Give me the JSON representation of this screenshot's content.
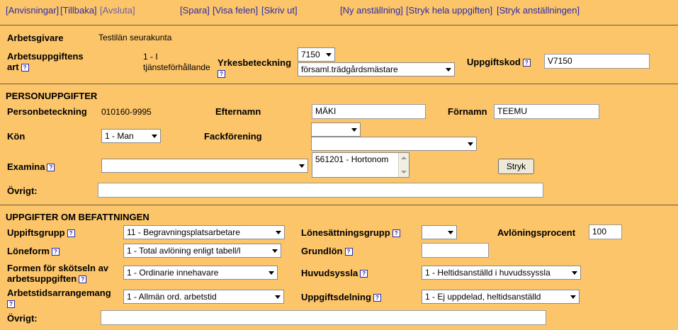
{
  "nav": {
    "anvisningar": "[Anvisningar]",
    "tillbaka": "[Tillbaka]",
    "avsluta": "[Avsluta]",
    "spara": "[Spara]",
    "visa_felen": "[Visa felen]",
    "skriv_ut": "[Skriv ut]",
    "ny_anstallning": "[Ny anställning]",
    "stryk_uppgiften": "[Stryk hela uppgiften]",
    "stryk_anstallningen": "[Stryk anställningen]"
  },
  "top": {
    "arbetsgivare_label": "Arbetsgivare",
    "arbetsgivare_value": "Testilän seurakunta",
    "art_label_1": "Arbetsuppgiftens",
    "art_label_2": "art",
    "art_value_1": "1 - I",
    "art_value_2": "tjänsteförhållande",
    "yrkes_label": "Yrkesbeteckning",
    "yrkes_code": "7150",
    "yrkes_name": "församl.trädgårdsmästare",
    "uppgiftskod_label": "Uppgiftskod",
    "uppgiftskod_value": "V7150"
  },
  "person": {
    "section_title": "PERSONUPPGIFTER",
    "personbeteckning_label": "Personbeteckning",
    "personbeteckning_value": "010160-9995",
    "efternamn_label": "Efternamn",
    "efternamn_value": "MÄKI",
    "fornamn_label": "Förnamn",
    "fornamn_value": "TEEMU",
    "kon_label": "Kön",
    "kon_value": "1 - Man",
    "fack_label": "Fackförening",
    "fack_value_1": "",
    "fack_value_2": "",
    "examina_label": "Examina",
    "examina_select": "",
    "examina_list": [
      "561201 - Hortonom"
    ],
    "stryk_label": "Stryk",
    "ovrigt_label": "Övrigt:",
    "ovrigt_value": ""
  },
  "job": {
    "section_title": "UPPGIFTER OM BEFATTNINGEN",
    "uppgiftsgrupp_label": "Uppiftsgrupp",
    "uppgiftsgrupp_value": "11 - Begravningsplatsarbetare",
    "lonesattning_label": "Lönesättningsgrupp",
    "lonesattning_value": "",
    "avloning_label": "Avlöningsprocent",
    "avloning_value": "100",
    "loneform_label": "Löneform",
    "loneform_value": "1 - Total avlöning enligt tabell/l",
    "grundlon_label": "Grundlön",
    "grundlon_value": "",
    "formen_label_1": "Formen för skötseln av",
    "formen_label_2": "arbetsuppgiften",
    "formen_value": "1 - Ordinarie innehavare",
    "huvudsyssla_label": "Huvudsyssla",
    "huvudsyssla_value": "1 - Heltidsanställd i huvudssyssla",
    "arbetstid_label": "Arbetstidsarrangemang",
    "arbetstid_value": "1 - Allmän ord. arbetstid",
    "uppgiftsdelning_label": "Uppgiftsdelning",
    "uppgiftsdelning_value": "1 - Ej uppdelad, heltidsanställd",
    "ovrigt_label": "Övrigt:",
    "ovrigt_value": ""
  },
  "help_glyph": "?",
  "icons": {
    "help": "help-icon",
    "dropdown": "chevron-down-icon"
  }
}
